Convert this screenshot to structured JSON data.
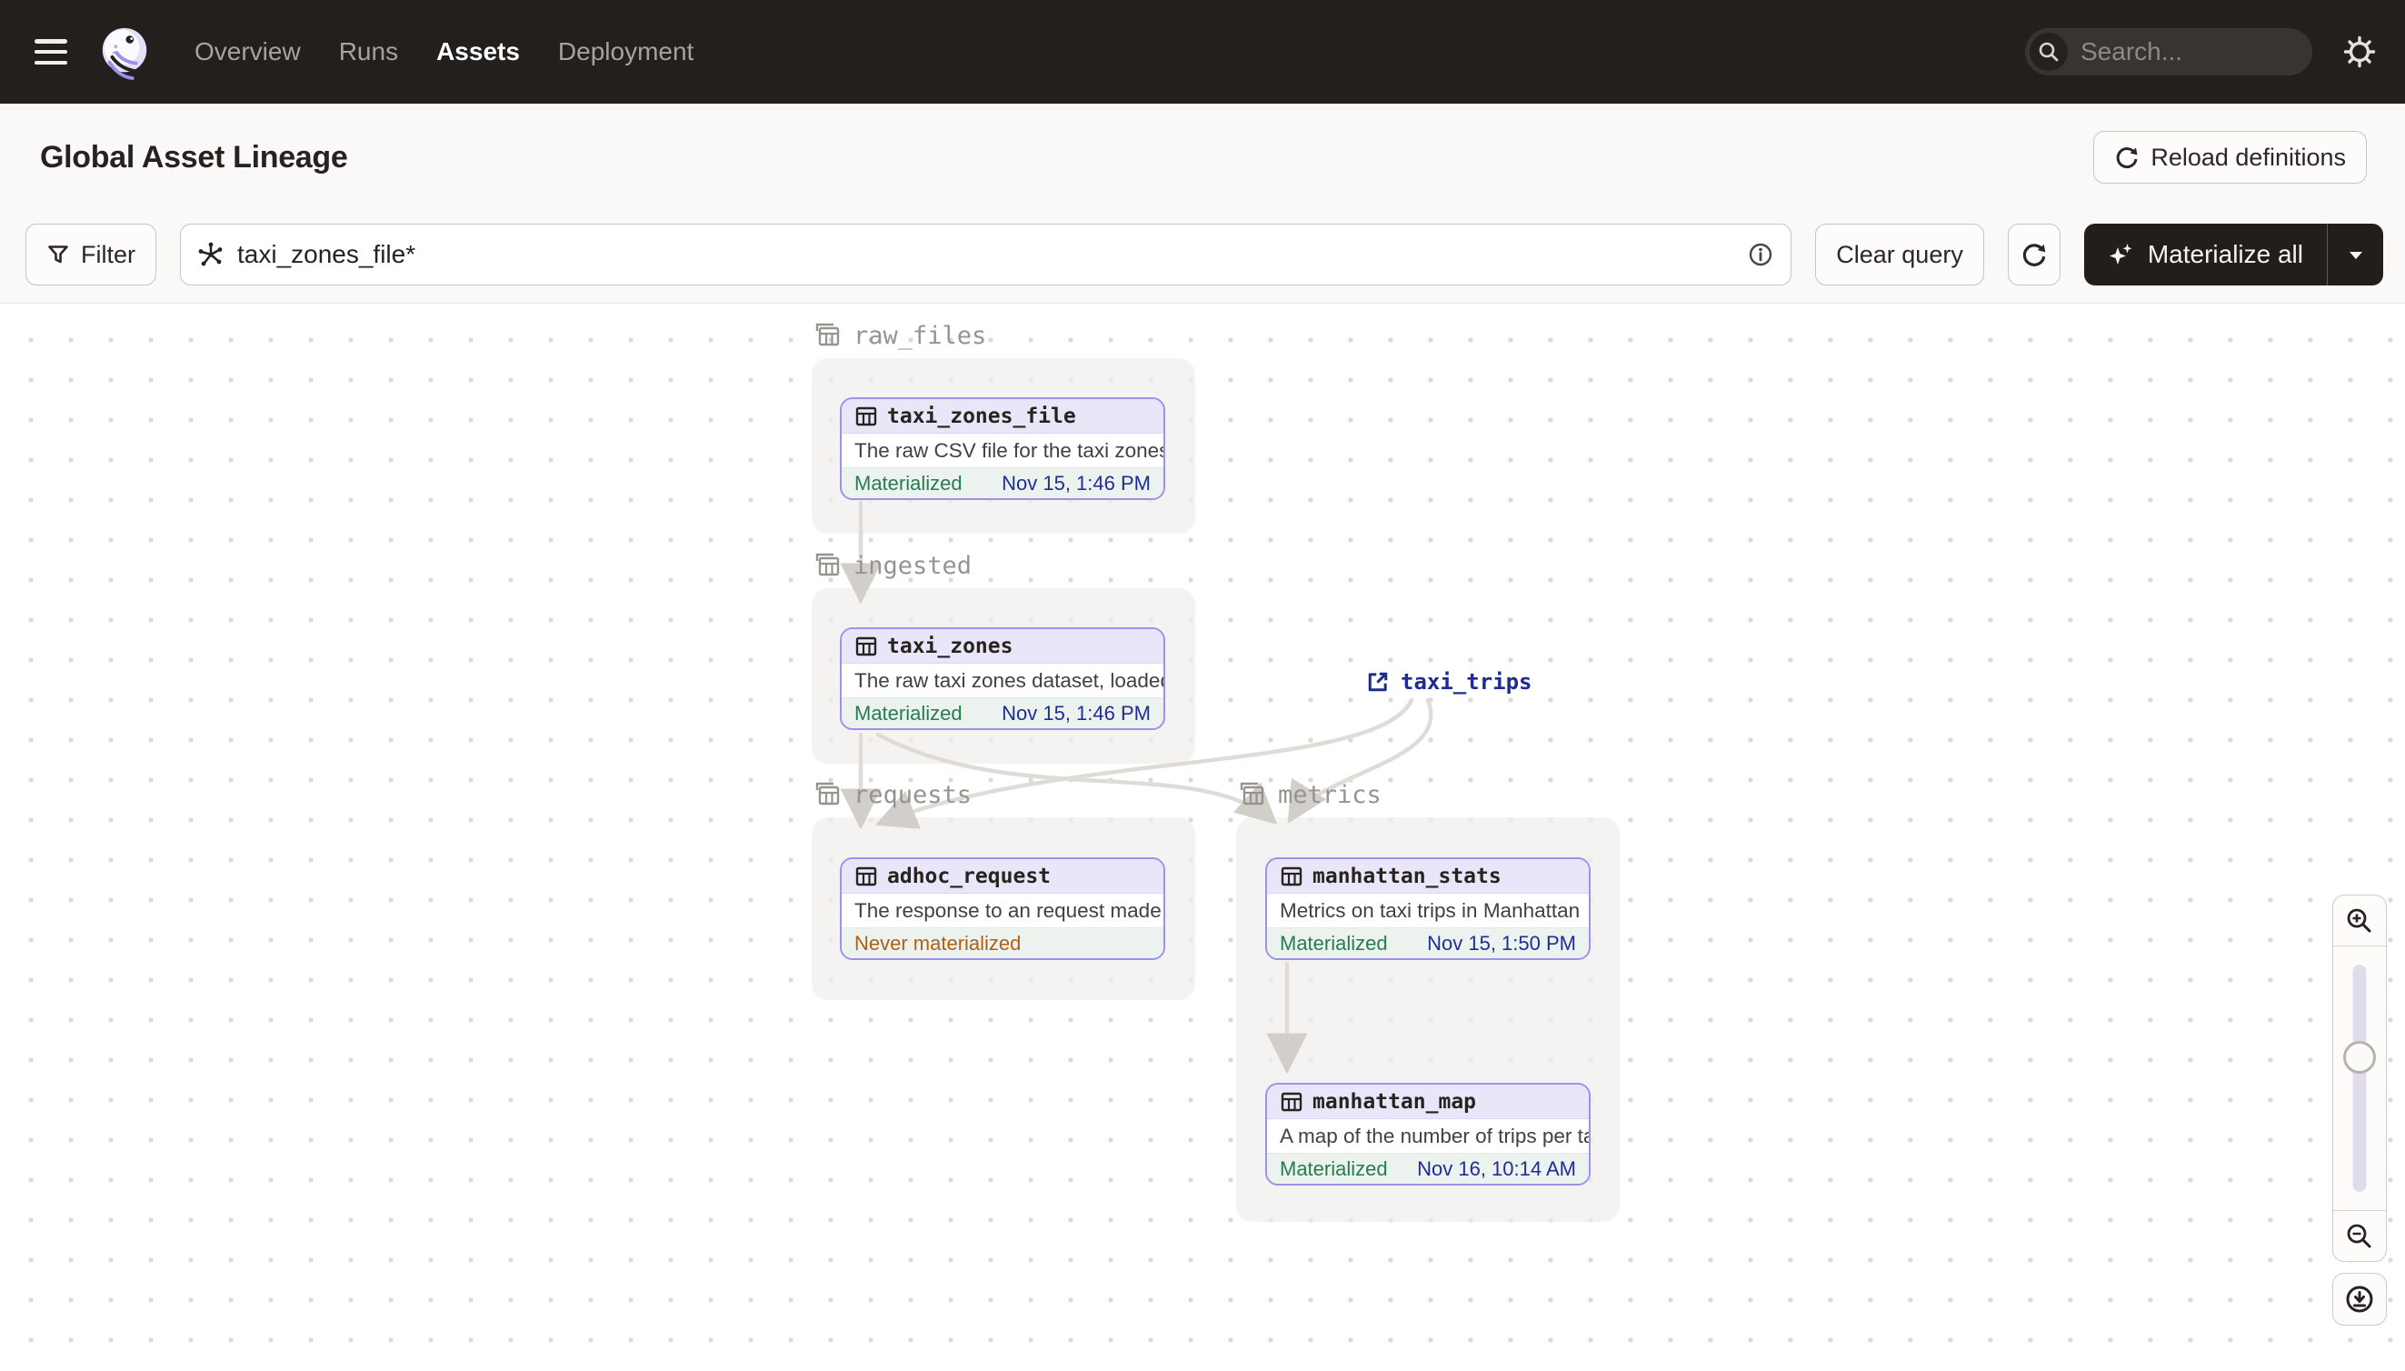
{
  "nav": {
    "links": [
      {
        "label": "Overview",
        "active": false
      },
      {
        "label": "Runs",
        "active": false
      },
      {
        "label": "Assets",
        "active": true
      },
      {
        "label": "Deployment",
        "active": false
      }
    ],
    "search_placeholder": "Search...",
    "search_shortcut": "/"
  },
  "header": {
    "title": "Global Asset Lineage",
    "reload_button_label": "Reload definitions"
  },
  "toolbar": {
    "filter_label": "Filter",
    "query_value": "taxi_zones_file*",
    "clear_query_label": "Clear query",
    "materialize_label": "Materialize all"
  },
  "graph": {
    "groups": [
      {
        "name": "raw_files"
      },
      {
        "name": "ingested"
      },
      {
        "name": "requests"
      },
      {
        "name": "metrics"
      }
    ],
    "nodes": [
      {
        "name": "taxi_zones_file",
        "description": "The raw CSV file for the taxi zones dat...",
        "status": "Materialized",
        "status_kind": "ok",
        "timestamp": "Nov 15, 1:46 PM"
      },
      {
        "name": "taxi_zones",
        "description": "The raw taxi zones dataset, loaded int...",
        "status": "Materialized",
        "status_kind": "ok",
        "timestamp": "Nov 15, 1:46 PM"
      },
      {
        "name": "adhoc_request",
        "description": "The response to an request made in th...",
        "status": "Never materialized",
        "status_kind": "never",
        "timestamp": ""
      },
      {
        "name": "manhattan_stats",
        "description": "Metrics on taxi trips in Manhattan",
        "status": "Materialized",
        "status_kind": "ok",
        "timestamp": "Nov 15, 1:50 PM"
      },
      {
        "name": "manhattan_map",
        "description": "A map of the number of trips per taxi z...",
        "status": "Materialized",
        "status_kind": "ok",
        "timestamp": "Nov 16, 10:14 AM"
      }
    ],
    "external_assets": [
      {
        "name": "taxi_trips"
      }
    ]
  },
  "icons": {
    "menu": "hamburger",
    "logo": "dagster-octopus",
    "search": "magnifier",
    "settings": "gear",
    "reload": "circular-arrow",
    "filter": "funnel",
    "query": "graph-asterisk",
    "info": "circled-i",
    "refresh": "circular-arrow",
    "materialize": "sparkle",
    "caret": "chevron-down",
    "group": "layered-table",
    "asset": "table-grid",
    "external": "external-link",
    "zoom_in": "magnifier-plus",
    "zoom_out": "magnifier-minus",
    "export": "circled-download"
  },
  "colors": {
    "nav_bg": "#231F1C",
    "accent_lavender": "#9E90EB",
    "node_header": "#EAE6F9",
    "status_green": "#277C50",
    "status_orange": "#B06018",
    "timestamp_navy": "#1F2D96",
    "edge_gray": "#DFDBD6",
    "group_bg": "#F0EDEA",
    "canvas_dot": "#DEDAD6"
  }
}
